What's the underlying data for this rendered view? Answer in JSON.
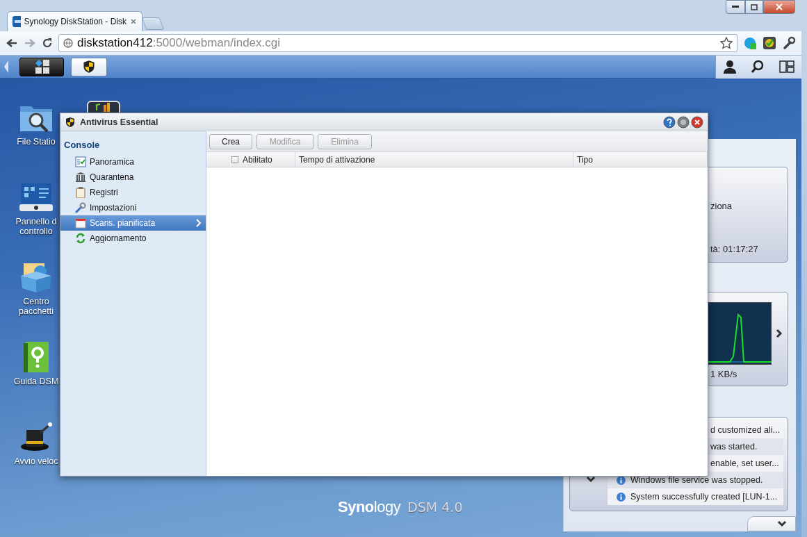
{
  "browser": {
    "tab": {
      "title": "Synology DiskStation - Disk"
    },
    "address": {
      "host": "diskstation412",
      "rest": ":5000/webman/index.cgi"
    }
  },
  "desktop": {
    "icons": [
      {
        "kind": "file-station",
        "lines": [
          "File Statio"
        ]
      },
      {
        "kind": "control-panel",
        "lines": [
          "Pannello d",
          "controllo"
        ]
      },
      {
        "kind": "package",
        "lines": [
          "Centro",
          "pacchetti"
        ]
      },
      {
        "kind": "help",
        "lines": [
          "Guida DSM"
        ]
      },
      {
        "kind": "quick-start",
        "lines": [
          "Avvio veloc"
        ]
      }
    ]
  },
  "window": {
    "title": "Antivirus Essential",
    "sidebar": {
      "heading": "Console",
      "items": [
        {
          "label": "Panoramica",
          "kind": "overview",
          "selected": false
        },
        {
          "label": "Quarantena",
          "kind": "quarantine",
          "selected": false
        },
        {
          "label": "Registri",
          "kind": "logs",
          "selected": false
        },
        {
          "label": "Impostazioni",
          "kind": "settings",
          "selected": false
        },
        {
          "label": "Scans. pianificata",
          "kind": "schedule",
          "selected": true
        },
        {
          "label": "Aggiornamento",
          "kind": "update",
          "selected": false
        }
      ]
    },
    "toolbar": [
      {
        "label": "Crea",
        "disabled": false
      },
      {
        "label": "Modifica",
        "disabled": true
      },
      {
        "label": "Elimina",
        "disabled": true
      }
    ],
    "table": {
      "columns": [
        {
          "label": "Abilitato",
          "checked": false
        },
        {
          "label": "Tempo di attivazione"
        },
        {
          "label": "Tipo"
        }
      ]
    }
  },
  "widgets": {
    "status": {
      "lines": [
        "ziona",
        "tà: 01:17:27"
      ]
    },
    "monitor": {
      "reading": "1 KB/s"
    },
    "logs": [
      {
        "text": "d customized ali...",
        "clipped": true
      },
      {
        "text": "was started.",
        "clipped": true
      },
      {
        "text": "enable, set user...",
        "clipped": true
      },
      {
        "text": "Windows file service was stopped.",
        "clipped": false
      },
      {
        "text": "System successfully created [LUN-1...",
        "clipped": false
      }
    ]
  },
  "footer": {
    "brand": "**Syno**logy",
    "product": "DSM 4.0"
  }
}
